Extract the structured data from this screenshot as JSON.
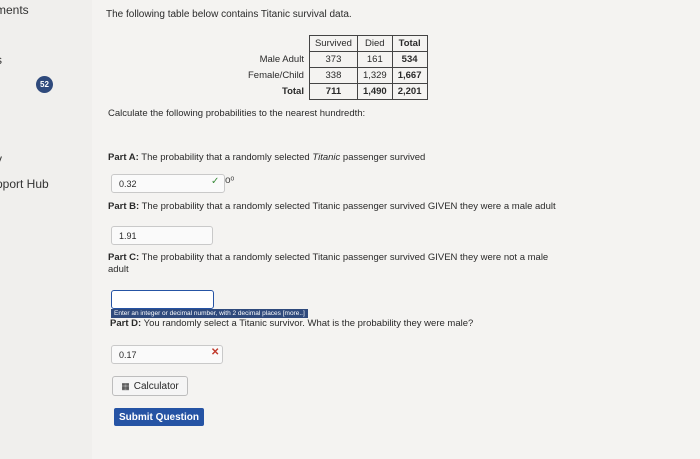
{
  "sidebar": {
    "items": [
      "ments",
      "s",
      "52",
      "y",
      "pport Hub"
    ]
  },
  "intro": "The following table below contains Titanic survival data.",
  "table": {
    "headers": [
      "Survived",
      "Died",
      "Total"
    ],
    "rows": [
      {
        "label": "Male Adult",
        "values": [
          "373",
          "161",
          "534"
        ]
      },
      {
        "label": "Female/Child",
        "values": [
          "338",
          "1,329",
          "1,667"
        ]
      },
      {
        "label": "Total",
        "values": [
          "711",
          "1,490",
          "2,201"
        ]
      }
    ]
  },
  "instruction": "Calculate the following probabilities to the nearest hundredth:",
  "partA": {
    "label": "Part A:",
    "text_before": " The probability that a randomly selected ",
    "italic": "Titanic",
    "text_after": " passenger survived",
    "answer": "0.32"
  },
  "partB": {
    "label": "Part B:",
    "text": " The probability that a randomly selected Titanic passenger survived GIVEN they were a male adult",
    "answer": "1.91"
  },
  "partC": {
    "label": "Part C:",
    "text": " The probability that a randomly selected Titanic passenger survived GIVEN they were not a male adult",
    "answer": "",
    "hint": "Enter an integer or decimal number, with 2 decimal places [more..]"
  },
  "partD": {
    "label": "Part D:",
    "text": " You randomly select a Titanic survivor. What is the probability they were male?",
    "answer": "0.17"
  },
  "calculator_label": "Calculator",
  "submit_label": "Submit Question",
  "colors": {
    "accent": "#2553a4",
    "badge": "#2f4a7c",
    "correct": "#3d8c3d",
    "wrong": "#c0392b"
  },
  "icons": [
    "check-icon",
    "key-icon",
    "x-icon",
    "calculator-icon"
  ]
}
